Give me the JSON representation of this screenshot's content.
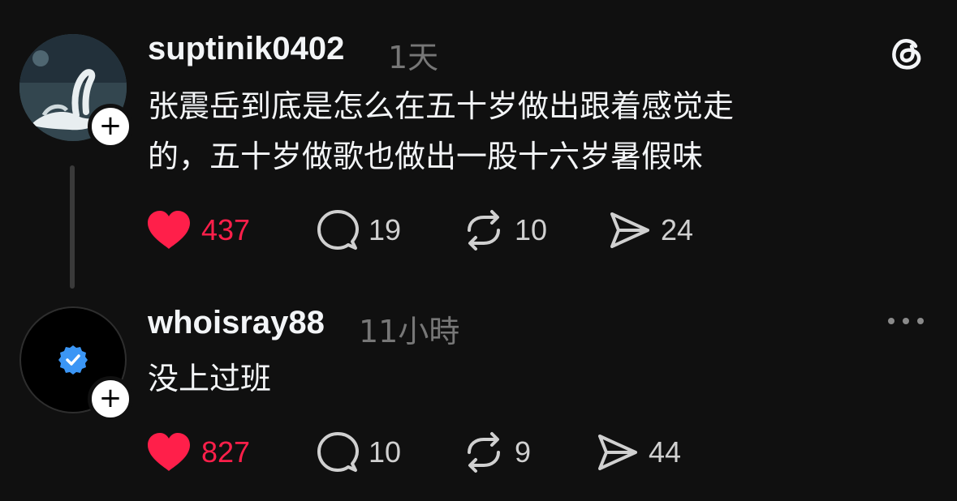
{
  "app": {
    "logo_icon": "threads-icon"
  },
  "posts": [
    {
      "username": "suptinik0402",
      "time": "1天",
      "avatar_icon": "swan-avatar",
      "text_lines": [
        "张震岳到底是怎么在五十岁做出跟着感觉走",
        "的，五十岁做歌也做出一股十六岁暑假味"
      ],
      "likes": "437",
      "comments": "19",
      "reposts": "10",
      "shares": "24",
      "liked": true
    },
    {
      "username": "whoisray88",
      "time": "11小時",
      "avatar_icon": "verified-badge-icon",
      "text_lines": [
        "没上过班"
      ],
      "likes": "827",
      "comments": "10",
      "reposts": "9",
      "shares": "44",
      "liked": true
    }
  ],
  "colors": {
    "background": "#101010",
    "like": "#ff1f4a",
    "muted": "#777777",
    "verified": "#3b96f5"
  }
}
